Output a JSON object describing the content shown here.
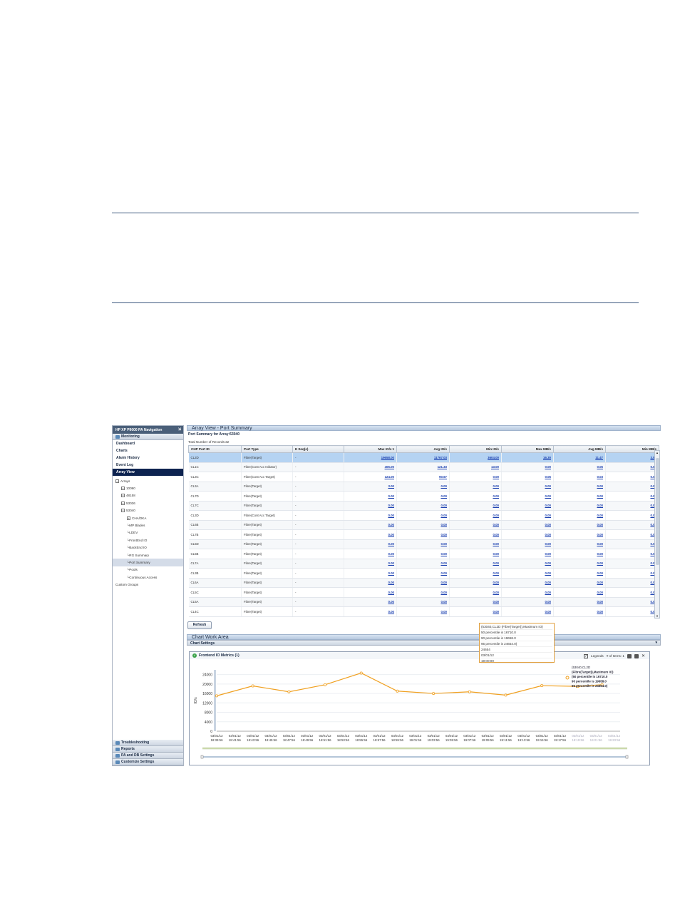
{
  "nav": {
    "header": "HP XP P9000 PA Navigation",
    "monitoring": "Monitoring",
    "items": [
      "Dashboard",
      "Charts",
      "Alarm History",
      "Event Log",
      "Array View"
    ],
    "tree": [
      {
        "label": "Arrays",
        "toggle": "−",
        "indent": 0
      },
      {
        "label": "10090",
        "toggle": "+",
        "indent": 1
      },
      {
        "label": "48158",
        "toggle": "+",
        "indent": 1
      },
      {
        "label": "53036",
        "toggle": "+",
        "indent": 1
      },
      {
        "label": "53040",
        "toggle": "−",
        "indent": 1
      },
      {
        "label": "CHA/DKA",
        "toggle": "+",
        "indent": 2
      },
      {
        "label": "MP Blades",
        "toggle": "",
        "indent": 2
      },
      {
        "label": "LDEV",
        "toggle": "",
        "indent": 2
      },
      {
        "label": "FrontEnd IO",
        "toggle": "",
        "indent": 2
      },
      {
        "label": "BackEnd IO",
        "toggle": "",
        "indent": 2
      },
      {
        "label": "RG Summary",
        "toggle": "",
        "indent": 2
      },
      {
        "label": "Port Summary",
        "toggle": "",
        "indent": 2
      },
      {
        "label": "Pools",
        "toggle": "",
        "indent": 2
      },
      {
        "label": "Continuous Access",
        "toggle": "",
        "indent": 2
      },
      {
        "label": "Custom Groups",
        "toggle": "",
        "indent": 0
      }
    ],
    "bottom": [
      "Troubleshooting",
      "Reports",
      "PA and DB Settings",
      "Customize Settings"
    ]
  },
  "main": {
    "title": "Array View - Port Summary",
    "subtitle": "Port Summary for Array:53040",
    "total": "Total Number of Records:32",
    "columns": [
      "CHP Port ID",
      "Port Type",
      "E Seq(s)",
      "Max IO/s ▾",
      "Avg IO/s",
      "Min IO/s",
      "Max MB/s",
      "Avg MB/s",
      "Min MB/s"
    ],
    "rows": [
      [
        "CL2D",
        "Fibre(Target)",
        "-",
        "19658.00",
        "11767.03",
        "3604.00",
        "16.30",
        "11.47",
        "3.57"
      ],
      [
        "CL1C",
        "Fibre(Cont Acc Initiator)",
        "-",
        "406.00",
        "121.33",
        "13.00",
        "0.00",
        "0.06",
        "0.03"
      ],
      [
        "CL3C",
        "Fibre(Cont Acc Target)",
        "-",
        "124.00",
        "90.67",
        "0.00",
        "0.06",
        "0.03",
        "0.00"
      ],
      [
        "CL3A",
        "Fibre(Target)",
        "-",
        "3.00",
        "0.00",
        "0.00",
        "0.00",
        "0.00",
        "0.00"
      ],
      [
        "CL7D",
        "Fibre(Target)",
        "-",
        "0.00",
        "0.00",
        "0.00",
        "0.00",
        "0.00",
        "0.00"
      ],
      [
        "CL7C",
        "Fibre(Target)",
        "-",
        "0.00",
        "0.00",
        "0.00",
        "0.00",
        "0.00",
        "0.00"
      ],
      [
        "CL3D",
        "Fibre(Cont Acc Target)",
        "-",
        "0.00",
        "0.00",
        "0.00",
        "0.00",
        "0.00",
        "0.00"
      ],
      [
        "CL6B",
        "Fibre(Target)",
        "-",
        "0.00",
        "0.00",
        "0.00",
        "0.00",
        "0.00",
        "0.00"
      ],
      [
        "CL7B",
        "Fibre(Target)",
        "-",
        "0.00",
        "0.00",
        "0.00",
        "0.00",
        "0.00",
        "0.00"
      ],
      [
        "CL5D",
        "Fibre(Target)",
        "-",
        "0.00",
        "0.00",
        "0.00",
        "0.00",
        "0.00",
        "0.00"
      ],
      [
        "CL5B",
        "Fibre(Target)",
        "-",
        "0.00",
        "0.00",
        "0.00",
        "0.00",
        "0.00",
        "0.00"
      ],
      [
        "CL7A",
        "Fibre(Target)",
        "-",
        "0.00",
        "0.00",
        "0.00",
        "0.00",
        "0.00",
        "0.00"
      ],
      [
        "CL3B",
        "Fibre(Target)",
        "-",
        "0.00",
        "0.00",
        "0.00",
        "0.00",
        "0.00",
        "0.00"
      ],
      [
        "CL6A",
        "Fibre(Target)",
        "-",
        "0.00",
        "0.00",
        "0.00",
        "0.00",
        "0.00",
        "0.00"
      ],
      [
        "CL5C",
        "Fibre(Target)",
        "-",
        "0.00",
        "0.00",
        "0.00",
        "0.00",
        "0.00",
        "0.00"
      ],
      [
        "CL5A",
        "Fibre(Target)",
        "-",
        "0.00",
        "0.00",
        "0.00",
        "0.00",
        "0.00",
        "0.00"
      ],
      [
        "CL4C",
        "Fibre(Target)",
        "-",
        "0.00",
        "0.00",
        "0.00",
        "0.00",
        "0.00",
        "0.00"
      ]
    ],
    "refresh": "Refresh",
    "chart_area_title": "Chart Work Area",
    "chart_settings": "Chart Settings"
  },
  "panel": {
    "title": "Frontend IO Metrics (1)",
    "legends": "Legends",
    "items": "# of Items: 1"
  },
  "tooltip": [
    "(53040,CL2D (Fibre(Target)),Maximum IO)",
    "50 percentile is 16710.0",
    "90 percentile is 19658.0",
    "95 percentile is 24654.0)",
    "24654",
    "03/01/12",
    "19:00:00"
  ],
  "legend": [
    "(53040,CL2D",
    "(Fibre(Target)),Maximum IO)",
    "(50 percentile is 16710.0",
    "90 percentile is 19658.0",
    "95 percentile is 24654.0)"
  ],
  "colors": {
    "series": "#f0a020",
    "nav_dark": "#0d2350",
    "link": "#1a3fb0"
  },
  "chart_data": {
    "type": "line",
    "ylabel": "IO/s",
    "yticks": [
      0,
      4000,
      8000,
      12000,
      16000,
      20000,
      24000
    ],
    "ylim": [
      0,
      26000
    ],
    "x": [
      "03/01/12 18:39:56",
      "03/01/12 18:41:56",
      "03/01/12 18:43:56",
      "03/01/12 18:45:56",
      "03/01/12 18:47:56",
      "03/01/12 18:49:56",
      "03/01/12 18:51:56",
      "03/01/12 18:53:56",
      "03/01/12 18:55:56",
      "03/01/12 18:57:56",
      "03/01/12 18:59:56",
      "03/01/12 19:01:56",
      "03/01/12 19:03:56",
      "03/01/12 19:05:56",
      "03/01/12 19:07:56",
      "03/01/12 19:09:56",
      "03/01/12 19:11:56",
      "03/01/12 19:13:56",
      "03/01/12 19:15:56",
      "03/01/12 19:17:56",
      "03/01/12 19:19:56",
      "03/01/12 19:21:56",
      "03/01/12 19:23:56"
    ],
    "series": [
      {
        "x_index": [
          0,
          3,
          6,
          9,
          12,
          15,
          18,
          21,
          24,
          27,
          30,
          32
        ],
        "values": [
          15000,
          19200,
          16700,
          19700,
          24654,
          17000,
          16000,
          16700,
          15300,
          19300,
          19000,
          19700
        ]
      }
    ]
  }
}
